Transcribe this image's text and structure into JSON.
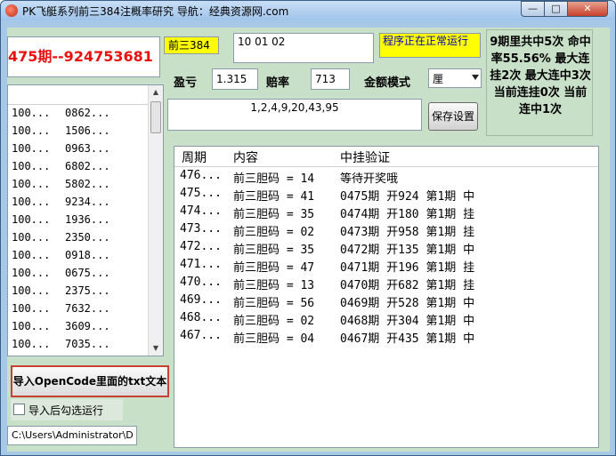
{
  "window": {
    "title": "PK飞艇系列前三384注概率研究 导航：经典资源网.com"
  },
  "left": {
    "period_display": "475期--924753681",
    "list_rows": [
      {
        "col1": "100...",
        "col2": "0862..."
      },
      {
        "col1": "100...",
        "col2": "1506..."
      },
      {
        "col1": "100...",
        "col2": "0963..."
      },
      {
        "col1": "100...",
        "col2": "6802..."
      },
      {
        "col1": "100...",
        "col2": "5802..."
      },
      {
        "col1": "100...",
        "col2": "9234..."
      },
      {
        "col1": "100...",
        "col2": "1936..."
      },
      {
        "col1": "100...",
        "col2": "2350..."
      },
      {
        "col1": "100...",
        "col2": "0918..."
      },
      {
        "col1": "100...",
        "col2": "0675..."
      },
      {
        "col1": "100...",
        "col2": "2375..."
      },
      {
        "col1": "100...",
        "col2": "7632..."
      },
      {
        "col1": "100...",
        "col2": "3609..."
      },
      {
        "col1": "100...",
        "col2": "7035..."
      }
    ],
    "import_button": "导入OpenCode里面的txt文本",
    "checkbox_label": "导入后勾选运行",
    "path_value": "C:\\Users\\Administrator\\D"
  },
  "top": {
    "mode_label": "前三384",
    "numbers_value": "10 01 02",
    "status_text": "程序正在正常运行",
    "stats_text": "9期里共中5次 命中率55.56% 最大连挂2次 最大连中3次 当前连挂0次 当前连中1次",
    "profit_label": "盈亏",
    "profit_value": "1.315",
    "odds_label": "赔率",
    "odds_value": "713",
    "amount_mode_label": "金额模式",
    "amount_mode_value": "厘",
    "sequence_value": "1,2,4,9,20,43,95",
    "save_button": "保存设置"
  },
  "results": {
    "headers": {
      "period": "周期",
      "content": "内容",
      "verify": "中挂验证"
    },
    "rows": [
      {
        "period": "476...",
        "content": "前三胆码 = 14",
        "verify": "等待开奖哦"
      },
      {
        "period": "475...",
        "content": "前三胆码 = 41",
        "verify": "0475期 开924 第1期 中"
      },
      {
        "period": "474...",
        "content": "前三胆码 = 35",
        "verify": "0474期 开180 第1期 挂"
      },
      {
        "period": "473...",
        "content": "前三胆码 = 02",
        "verify": "0473期 开958 第1期 挂"
      },
      {
        "period": "472...",
        "content": "前三胆码 = 35",
        "verify": "0472期 开135 第1期 中"
      },
      {
        "period": "471...",
        "content": "前三胆码 = 47",
        "verify": "0471期 开196 第1期 挂"
      },
      {
        "period": "470...",
        "content": "前三胆码 = 13",
        "verify": "0470期 开682 第1期 挂"
      },
      {
        "period": "469...",
        "content": "前三胆码 = 56",
        "verify": "0469期 开528 第1期 中"
      },
      {
        "period": "468...",
        "content": "前三胆码 = 02",
        "verify": "0468期 开304 第1期 中"
      },
      {
        "period": "467...",
        "content": "前三胆码 = 04",
        "verify": "0467期 开435 第1期 中"
      }
    ]
  }
}
